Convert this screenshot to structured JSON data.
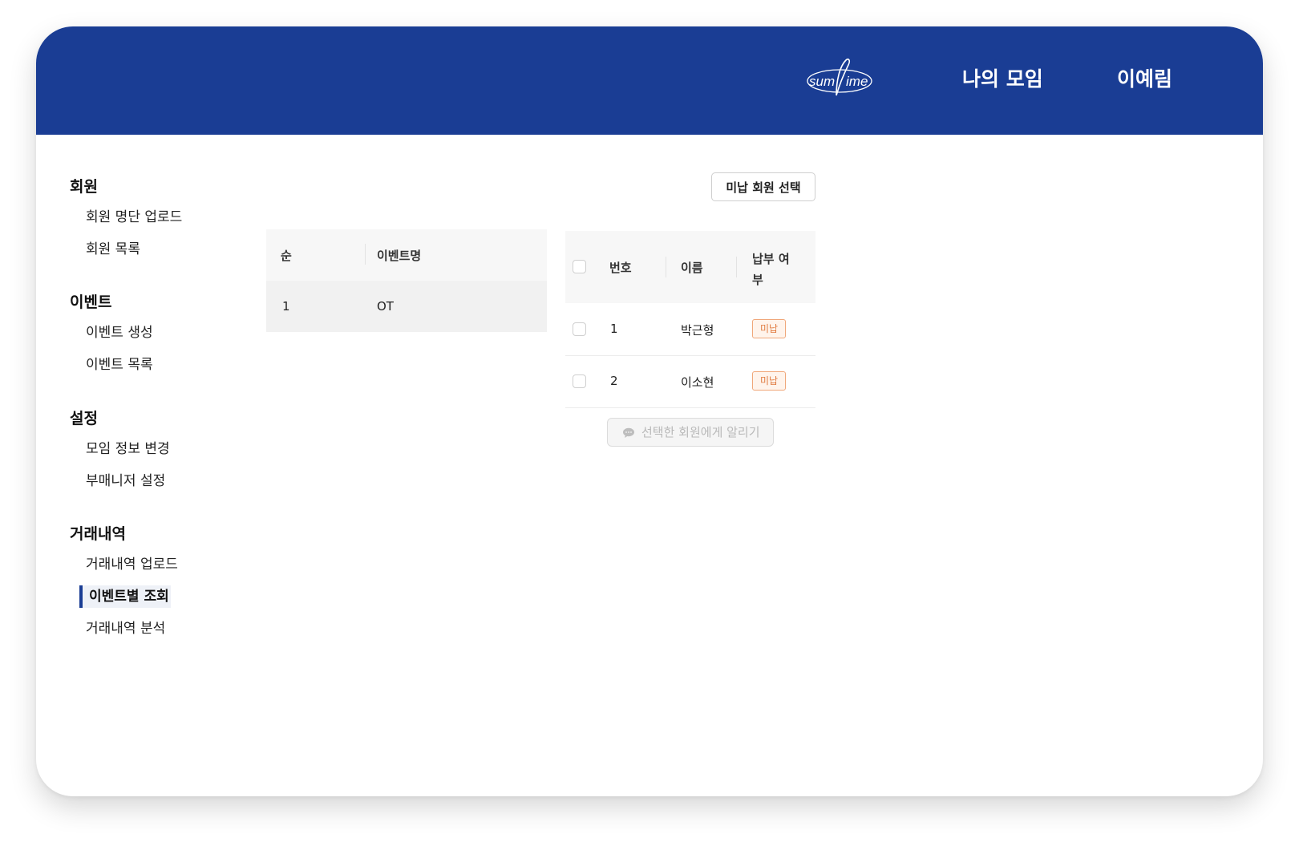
{
  "header": {
    "brand": "sumtime",
    "nav": {
      "my_groups": "나의 모임",
      "user_name": "이예림"
    },
    "colors": {
      "primary": "#1a3d94"
    }
  },
  "sidebar": {
    "sections": [
      {
        "title": "회원",
        "items": [
          "회원 명단 업로드",
          "회원 목록"
        ]
      },
      {
        "title": "이벤트",
        "items": [
          "이벤트 생성",
          "이벤트 목록"
        ]
      },
      {
        "title": "설정",
        "items": [
          "모임 정보 변경",
          "부매니저 설정"
        ]
      },
      {
        "title": "거래내역",
        "items": [
          "거래내역 업로드",
          "이벤트별 조회",
          "거래내역 분석"
        ]
      }
    ],
    "active_item": "이벤트별 조회"
  },
  "event_table": {
    "headers": [
      "순",
      "이벤트명"
    ],
    "rows": [
      {
        "no": "1",
        "name": "OT"
      }
    ]
  },
  "member_panel": {
    "select_unpaid_label": "미납 회원 선택",
    "headers": [
      "번호",
      "이름",
      "납부 여부"
    ],
    "rows": [
      {
        "no": "1",
        "name": "박근형",
        "status": "미납"
      },
      {
        "no": "2",
        "name": "이소현",
        "status": "미납"
      }
    ],
    "notify_label": "선택한 회원에게 알리기",
    "notify_icon": "chat-bubble-icon",
    "colors": {
      "unpaid_badge": "#e07a3f"
    }
  }
}
